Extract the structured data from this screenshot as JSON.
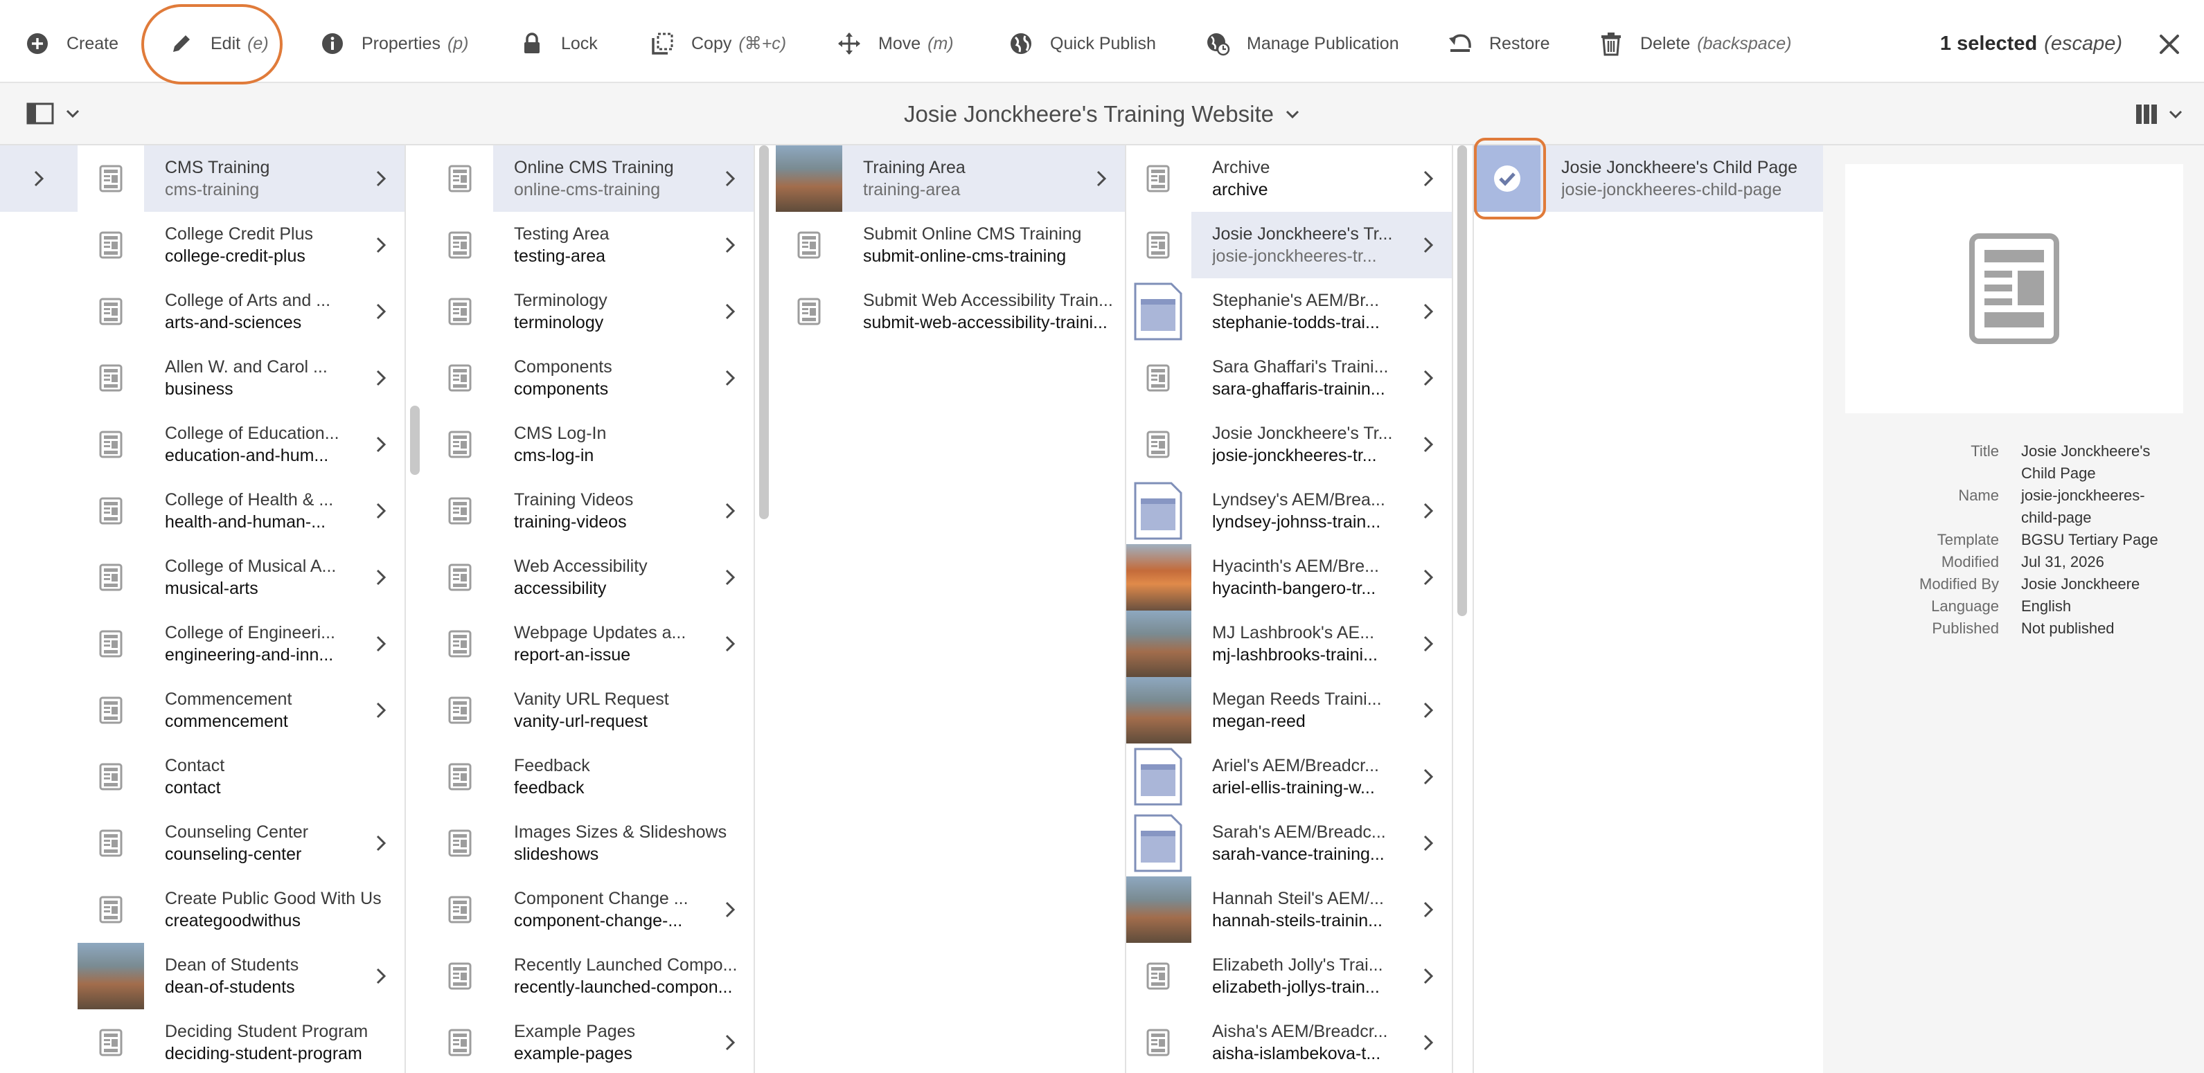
{
  "actions": [
    {
      "key": "create",
      "label": "Create",
      "shortcut": "",
      "icon": "plus-circle-icon"
    },
    {
      "key": "edit",
      "label": "Edit",
      "shortcut": "(e)",
      "icon": "pencil-icon"
    },
    {
      "key": "properties",
      "label": "Properties",
      "shortcut": "(p)",
      "icon": "info-icon"
    },
    {
      "key": "lock",
      "label": "Lock",
      "shortcut": "",
      "icon": "lock-icon"
    },
    {
      "key": "copy",
      "label": "Copy",
      "shortcut": "(⌘+c)",
      "icon": "copy-icon"
    },
    {
      "key": "move",
      "label": "Move",
      "shortcut": "(m)",
      "icon": "move-icon"
    },
    {
      "key": "quick_publish",
      "label": "Quick Publish",
      "shortcut": "",
      "icon": "globe-icon"
    },
    {
      "key": "manage_publication",
      "label": "Manage Publication",
      "shortcut": "",
      "icon": "globe-clock-icon"
    },
    {
      "key": "restore",
      "label": "Restore",
      "shortcut": "",
      "icon": "restore-icon"
    },
    {
      "key": "delete",
      "label": "Delete",
      "shortcut": "(backspace)",
      "icon": "trash-icon"
    }
  ],
  "selection": {
    "count_label": "1 selected",
    "shortcut": "(escape)"
  },
  "title": "Josie Jonckheere's Training Website",
  "columns": [
    {
      "items": [
        {
          "t": "CMS Training",
          "n": "cms-training",
          "chev": true,
          "sel": true
        },
        {
          "t": "College Credit Plus",
          "n": "college-credit-plus",
          "chev": true
        },
        {
          "t": "College of Arts and ...",
          "n": "arts-and-sciences",
          "chev": true
        },
        {
          "t": "Allen W. and Carol ...",
          "n": "business",
          "chev": true
        },
        {
          "t": "College of Education...",
          "n": "education-and-hum...",
          "chev": true
        },
        {
          "t": "College of Health & ...",
          "n": "health-and-human-...",
          "chev": true
        },
        {
          "t": "College of Musical A...",
          "n": "musical-arts",
          "chev": true
        },
        {
          "t": "College of Engineeri...",
          "n": "engineering-and-inn...",
          "chev": true
        },
        {
          "t": "Commencement",
          "n": "commencement",
          "chev": true
        },
        {
          "t": "Contact",
          "n": "contact",
          "chev": false
        },
        {
          "t": "Counseling Center",
          "n": "counseling-center",
          "chev": true
        },
        {
          "t": "Create Public Good With Us",
          "n": "creategoodwithus",
          "chev": false
        },
        {
          "t": "Dean of Students",
          "n": "dean-of-students",
          "chev": true,
          "thumb": "photo"
        },
        {
          "t": "Deciding Student Program",
          "n": "deciding-student-program",
          "chev": false
        }
      ]
    },
    {
      "items": [
        {
          "t": "Online CMS Training",
          "n": "online-cms-training",
          "chev": true,
          "sel": true
        },
        {
          "t": "Testing Area",
          "n": "testing-area",
          "chev": true
        },
        {
          "t": "Terminology",
          "n": "terminology",
          "chev": true
        },
        {
          "t": "Components",
          "n": "components",
          "chev": true
        },
        {
          "t": "CMS Log-In",
          "n": "cms-log-in",
          "chev": false
        },
        {
          "t": "Training Videos",
          "n": "training-videos",
          "chev": true
        },
        {
          "t": "Web Accessibility",
          "n": "accessibility",
          "chev": true
        },
        {
          "t": "Webpage Updates a...",
          "n": "report-an-issue",
          "chev": true
        },
        {
          "t": "Vanity URL Request",
          "n": "vanity-url-request",
          "chev": false
        },
        {
          "t": "Feedback",
          "n": "feedback",
          "chev": false
        },
        {
          "t": "Images Sizes & Slideshows",
          "n": "slideshows",
          "chev": false
        },
        {
          "t": "Component Change ...",
          "n": "component-change-...",
          "chev": true
        },
        {
          "t": "Recently Launched Compo...",
          "n": "recently-launched-compon...",
          "chev": false
        },
        {
          "t": "Example Pages",
          "n": "example-pages",
          "chev": true
        }
      ]
    },
    {
      "items": [
        {
          "t": "Training Area",
          "n": "training-area",
          "chev": true,
          "sel": true,
          "thumb": "photo"
        },
        {
          "t": "Submit Online CMS Training",
          "n": "submit-online-cms-training",
          "chev": false
        },
        {
          "t": "Submit Web Accessibility Train...",
          "n": "submit-web-accessibility-traini...",
          "chev": false
        }
      ]
    },
    {
      "items": [
        {
          "t": "Archive",
          "n": "archive",
          "chev": true
        },
        {
          "t": "Josie Jonckheere's Tr...",
          "n": "josie-jonckheeres-tr...",
          "chev": true,
          "sel": true
        },
        {
          "t": "Stephanie's AEM/Br...",
          "n": "stephanie-todds-trai...",
          "chev": true,
          "thumb": "doc"
        },
        {
          "t": "Sara Ghaffari's Traini...",
          "n": "sara-ghaffaris-trainin...",
          "chev": true
        },
        {
          "t": "Josie Jonckheere's Tr...",
          "n": "josie-jonckheeres-tr...",
          "chev": true
        },
        {
          "t": "Lyndsey's AEM/Brea...",
          "n": "lyndsey-johnss-train...",
          "chev": true,
          "thumb": "doc"
        },
        {
          "t": "Hyacinth's AEM/Bre...",
          "n": "hyacinth-bangero-tr...",
          "chev": true,
          "thumb": "photo2"
        },
        {
          "t": "MJ Lashbrook's AE...",
          "n": "mj-lashbrooks-traini...",
          "chev": true,
          "thumb": "photo"
        },
        {
          "t": "Megan Reeds Traini...",
          "n": "megan-reed",
          "chev": true,
          "thumb": "photo"
        },
        {
          "t": "Ariel's AEM/Breadcr...",
          "n": "ariel-ellis-training-w...",
          "chev": true,
          "thumb": "doc"
        },
        {
          "t": "Sarah's AEM/Breadc...",
          "n": "sarah-vance-training...",
          "chev": true,
          "thumb": "doc"
        },
        {
          "t": "Hannah Steil's AEM/...",
          "n": "hannah-steils-trainin...",
          "chev": true,
          "thumb": "photo"
        },
        {
          "t": "Elizabeth Jolly's Trai...",
          "n": "elizabeth-jollys-train...",
          "chev": true
        },
        {
          "t": "Aisha's AEM/Breadcr...",
          "n": "aisha-islambekova-t...",
          "chev": true
        }
      ]
    },
    {
      "items": [
        {
          "t": "Josie Jonckheere's Child Page",
          "n": "josie-jonckheeres-child-page",
          "chev": false,
          "sel": true,
          "checked": true
        }
      ]
    }
  ],
  "details": [
    {
      "k": "Title",
      "v": "Josie Jonckheere's Child Page"
    },
    {
      "k": "Name",
      "v": "josie-jonckheeres-child-page"
    },
    {
      "k": "Template",
      "v": "BGSU Tertiary Page"
    },
    {
      "k": "Modified",
      "v": "Jul 31, 2026"
    },
    {
      "k": "Modified By",
      "v": "Josie Jonckheere"
    },
    {
      "k": "Language",
      "v": "English"
    },
    {
      "k": "Published",
      "v": "Not published"
    }
  ],
  "colors": {
    "accent_annotation": "#e07b3a",
    "selected_row": "#e7eaf3",
    "checked_thumb": "#a9b9e0"
  }
}
